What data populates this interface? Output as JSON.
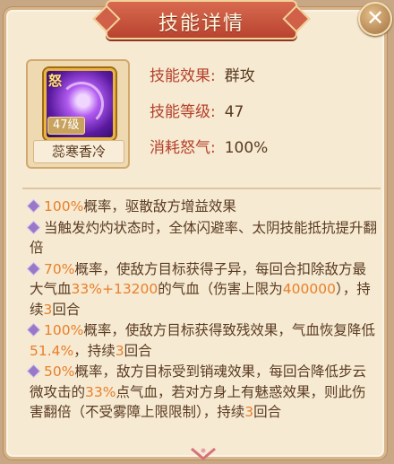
{
  "title": "技能详情",
  "close_icon": "close-icon",
  "skill": {
    "name": "蕊寒香冷",
    "level_badge": "47级",
    "icon_glyph": "怒",
    "icon": "purple-swirl-skill-icon"
  },
  "info": {
    "effect_label": "技能效果:",
    "effect_value": "群攻",
    "level_label": "技能等级:",
    "level_value": "47",
    "cost_label": "消耗怒气:",
    "cost_value": "100%"
  },
  "effects": [
    {
      "parts": [
        {
          "t": "100%",
          "hl": true
        },
        {
          "t": "概率，驱散敌方增益效果"
        }
      ]
    },
    {
      "parts": [
        {
          "t": "当触发灼灼状态时，全体闪避率、太阴技能抵抗提升翻倍"
        }
      ]
    },
    {
      "parts": [
        {
          "t": "70%",
          "hl": true
        },
        {
          "t": "概率，使敌方目标获得子异，每回合扣除敌方最大气血"
        },
        {
          "t": "33%+13200",
          "hl": true
        },
        {
          "t": "的气血（伤害上限为"
        },
        {
          "t": "400000",
          "hl": true
        },
        {
          "t": "），持续"
        },
        {
          "t": "3",
          "hl": true
        },
        {
          "t": "回合"
        }
      ]
    },
    {
      "parts": [
        {
          "t": "100%",
          "hl": true
        },
        {
          "t": "概率，使敌方目标获得致残效果，气血恢复降低"
        },
        {
          "t": "51.4%",
          "hl": true
        },
        {
          "t": "，持续"
        },
        {
          "t": "3",
          "hl": true
        },
        {
          "t": "回合"
        }
      ]
    },
    {
      "parts": [
        {
          "t": "50%",
          "hl": true
        },
        {
          "t": "概率，敌方目标受到销魂效果，每回合降低步云微攻击的"
        },
        {
          "t": "33%",
          "hl": true
        },
        {
          "t": "点气血，若对方身上有魅惑效果，则此伤害翻倍（不受雾障上限限制），持续"
        },
        {
          "t": "3",
          "hl": true
        },
        {
          "t": "回合"
        }
      ]
    }
  ],
  "colors": {
    "highlight": "#e8802a",
    "label": "#b5402a",
    "text": "#5a3a20",
    "panel": "#f6ead3"
  }
}
